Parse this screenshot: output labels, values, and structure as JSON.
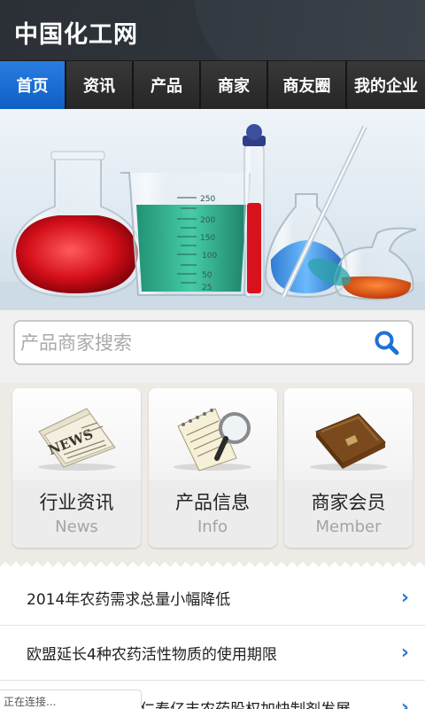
{
  "header": {
    "title": "中国化工网"
  },
  "nav": {
    "items": [
      {
        "label": "首页",
        "active": true
      },
      {
        "label": "资讯"
      },
      {
        "label": "产品"
      },
      {
        "label": "商家"
      },
      {
        "label": "商友圈"
      },
      {
        "label": "我的企业"
      }
    ]
  },
  "banner": {
    "beaker_ticks": [
      "250",
      "200",
      "150",
      "100",
      "50",
      "25"
    ]
  },
  "search": {
    "placeholder": "产品商家搜索",
    "icon": "search-icon"
  },
  "cards": [
    {
      "title": "行业资讯",
      "subtitle": "News",
      "icon": "newspaper-icon"
    },
    {
      "title": "产品信息",
      "subtitle": "Info",
      "icon": "notepad-magnifier-icon"
    },
    {
      "title": "商家会员",
      "subtitle": "Member",
      "icon": "briefcase-icon"
    }
  ],
  "news": {
    "items": [
      "2014年农药需求总量小幅降低",
      "欧盟延长4种农药活性物质的使用期限",
      "仁寿亿丰农药股权加快制剂发展"
    ]
  },
  "status": {
    "text": "正在连接..."
  },
  "colors": {
    "accent": "#1565c8",
    "nav_bg": "#2c2c2c",
    "header_bg": "#2f353c",
    "chevron": "#2a78d8"
  }
}
